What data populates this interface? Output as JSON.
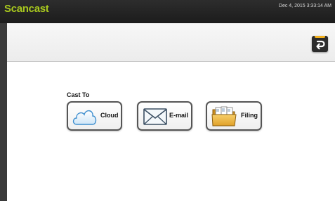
{
  "header": {
    "app_title": "Scancast",
    "datetime": "Dec 4, 2015 3:33:14 AM",
    "title_color": "#a8c81e"
  },
  "toolbar": {
    "back_icon": "return-arrow-icon",
    "accent_color": "#f2b01e"
  },
  "main": {
    "section_label": "Cast To",
    "buttons": [
      {
        "label": "Cloud",
        "icon": "cloud-icon"
      },
      {
        "label": "E-mail",
        "icon": "envelope-icon"
      },
      {
        "label": "Filing",
        "icon": "folder-icon"
      }
    ]
  }
}
